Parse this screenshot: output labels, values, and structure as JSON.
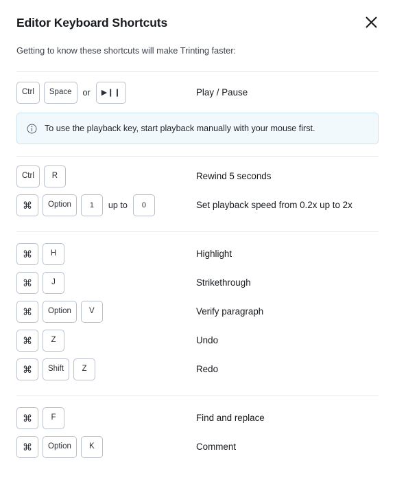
{
  "dialog": {
    "title": "Editor Keyboard Shortcuts",
    "subtitle": "Getting to know these shortcuts will make Trinting faster:",
    "close_label": "×"
  },
  "colors": {
    "callout_bg": "#f2f9fd",
    "callout_border": "#c8e3f4",
    "key_border": "#b9bfcc",
    "divider": "#e6e8ec",
    "text": "#16191d"
  },
  "callout": {
    "icon": "info-circle-icon",
    "text": "To use the playback key, start playback manually with your mouse first."
  },
  "sections": [
    {
      "rows": [
        {
          "keys": [
            "Ctrl",
            "Space"
          ],
          "joiner": "or",
          "alt_keys": [
            "▶❙❙"
          ],
          "desc": "Play / Pause"
        }
      ]
    },
    {
      "rows": [
        {
          "keys": [
            "Ctrl",
            "R"
          ],
          "desc": "Rewind 5 seconds"
        },
        {
          "keys": [
            "⌘",
            "Option",
            "1"
          ],
          "joiner": "up to",
          "alt_keys": [
            "0"
          ],
          "desc": "Set playback speed from 0.2x up to 2x"
        }
      ]
    },
    {
      "rows": [
        {
          "keys": [
            "⌘",
            "H"
          ],
          "desc": "Highlight"
        },
        {
          "keys": [
            "⌘",
            "J"
          ],
          "desc": "Strikethrough"
        },
        {
          "keys": [
            "⌘",
            "Option",
            "V"
          ],
          "desc": "Verify paragraph"
        },
        {
          "keys": [
            "⌘",
            "Z"
          ],
          "desc": "Undo"
        },
        {
          "keys": [
            "⌘",
            "Shift",
            "Z"
          ],
          "desc": "Redo"
        }
      ]
    },
    {
      "rows": [
        {
          "keys": [
            "⌘",
            "F"
          ],
          "desc": "Find and replace"
        },
        {
          "keys": [
            "⌘",
            "Option",
            "K"
          ],
          "desc": "Comment"
        }
      ]
    }
  ]
}
